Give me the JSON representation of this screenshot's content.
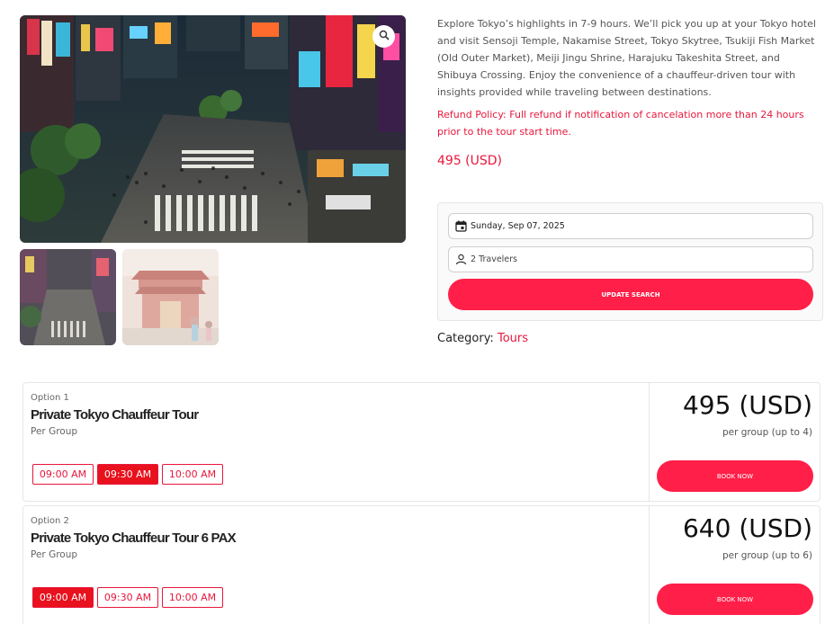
{
  "gallery": {
    "main_image_alt": "Shibuya Crossing at night",
    "thumbnails": [
      "Shibuya Crossing thumbnail",
      "Sensoji Temple thumbnail"
    ],
    "zoom_icon": "magnifier-icon"
  },
  "tour": {
    "description": "Explore Tokyo’s highlights in 7-9 hours. We’ll pick you up at your Tokyo hotel and visit Sensoji Temple, Nakamise Street, Tokyo Skytree, Tsukiji Fish Market (Old Outer Market), Meiji Jingu Shrine, Harajuku Takeshita Street, and Shibuya Crossing. Enjoy the convenience of a chauffeur-driven tour with insights provided while traveling between destinations.",
    "refund_policy": "Refund Policy: Full refund if notification of cancelation more than 24 hours prior to the tour start time.",
    "price": "495 (USD)"
  },
  "search": {
    "date_value": "Sunday, Sep 07, 2025",
    "travelers_value": "2 Travelers",
    "update_button": "UPDATE SEARCH",
    "calendar_icon": "calendar-icon",
    "person_icon": "person-icon"
  },
  "category": {
    "label": "Category:",
    "value": "Tours"
  },
  "options": [
    {
      "label": "Option 1",
      "title": "Private Tokyo Chauffeur Tour",
      "subtitle": "Per Group",
      "times": [
        "09:00 AM",
        "09:30 AM",
        "10:00 AM"
      ],
      "selected_time": "09:30 AM",
      "price": "495 (USD)",
      "per": "per group (up to 4)",
      "book_button": "BOOK NOW"
    },
    {
      "label": "Option 2",
      "title": "Private Tokyo Chauffeur Tour 6 PAX",
      "subtitle": "Per Group",
      "times": [
        "09:00 AM",
        "09:30 AM",
        "10:00 AM"
      ],
      "selected_time": "09:00 AM",
      "price": "640 (USD)",
      "per": "per group (up to 6)",
      "book_button": "BOOK NOW"
    }
  ],
  "colors": {
    "accent": "#ff1f48",
    "accent_text": "#e8173c",
    "selected_time": "#e8111d"
  }
}
